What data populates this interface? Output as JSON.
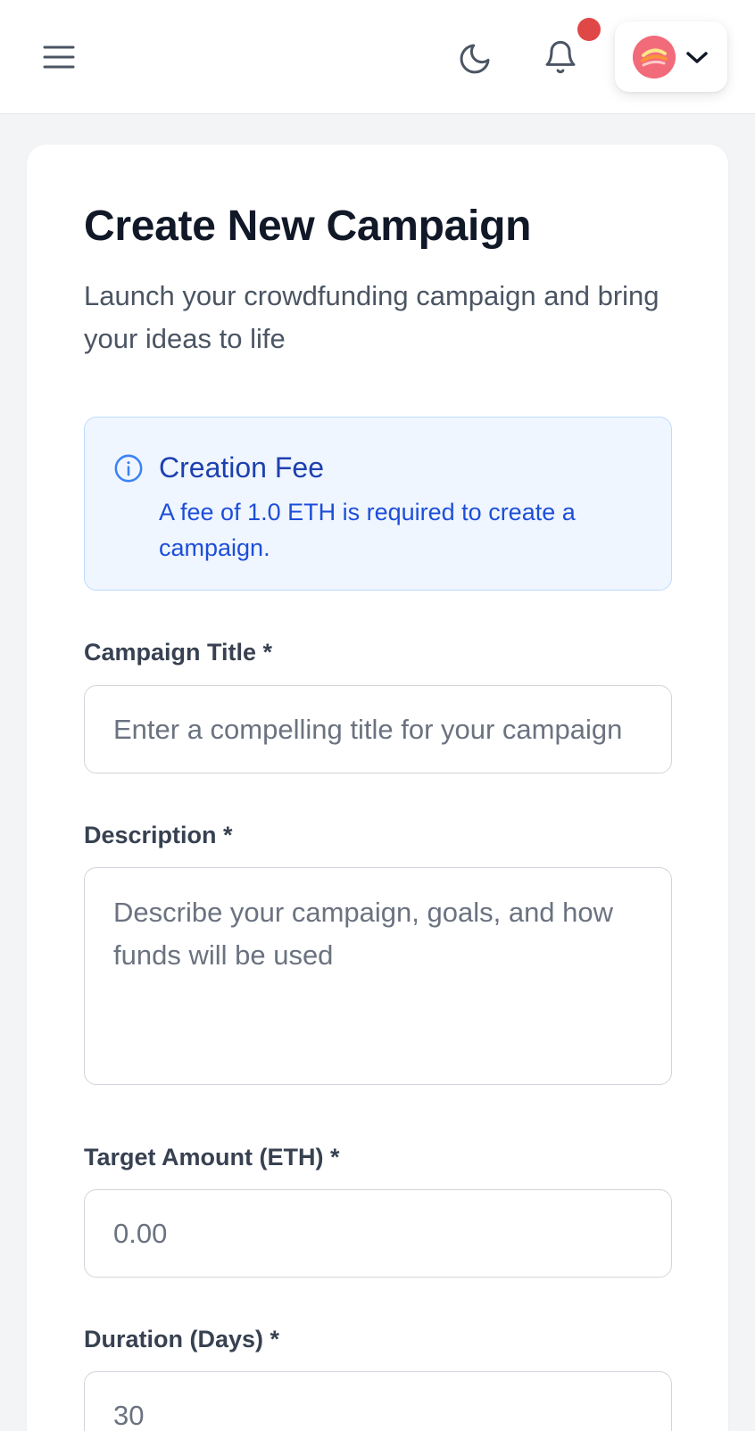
{
  "header": {
    "menu_icon": "hamburger-menu-icon",
    "theme_icon": "moon-icon",
    "notification_icon": "bell-icon",
    "avatar_icon": "avatar-icon",
    "dropdown_icon": "chevron-down-icon"
  },
  "colors": {
    "notification_dot": "#e04848",
    "avatar_bg": "#f26b7a",
    "info_bg": "#eff6ff",
    "info_text": "#1d4ed8"
  },
  "form": {
    "title": "Create New Campaign",
    "subtitle": "Launch your crowdfunding campaign and bring your ideas to life",
    "fee_notice": {
      "icon": "info-icon",
      "title": "Creation Fee",
      "text": "A fee of 1.0 ETH is required to create a campaign."
    },
    "fields": {
      "title": {
        "label": "Campaign Title *",
        "placeholder": "Enter a compelling title for your campaign",
        "value": ""
      },
      "description": {
        "label": "Description *",
        "placeholder": "Describe your campaign, goals, and how funds will be used",
        "value": ""
      },
      "target": {
        "label": "Target Amount (ETH) *",
        "placeholder": "0.00",
        "value": ""
      },
      "duration": {
        "label": "Duration (Days) *",
        "placeholder": "30",
        "value": ""
      }
    }
  }
}
